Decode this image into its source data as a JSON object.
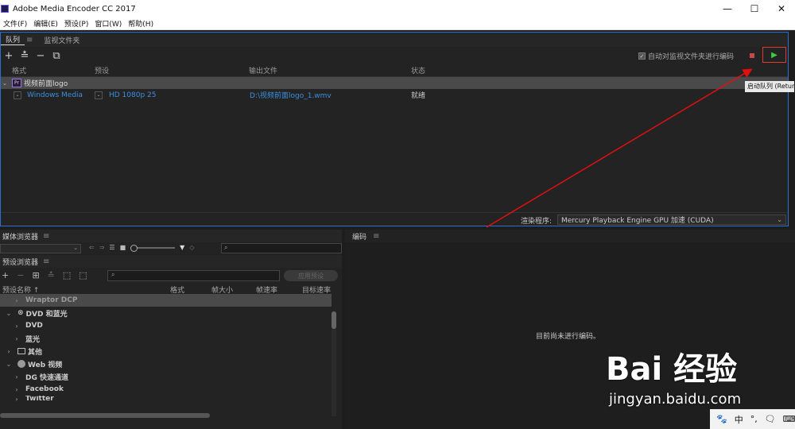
{
  "window": {
    "title": "Adobe Media Encoder CC 2017",
    "min": "—",
    "max": "☐",
    "close": "✕"
  },
  "menu": [
    "文件(F)",
    "编辑(E)",
    "预设(P)",
    "窗口(W)",
    "帮助(H)"
  ],
  "queue": {
    "tabs": [
      "队列",
      "监视文件夹"
    ],
    "auto_watch_label": "自动对监视文件夹进行编码",
    "auto_watch_checked": true,
    "tooltip": "启动队列 (Return)",
    "columns": [
      "格式",
      "预设",
      "输出文件",
      "状态"
    ],
    "group": {
      "badge": "Pr",
      "name": "视频前面logo"
    },
    "item": {
      "format": "Windows Media",
      "preset": "HD 1080p 25",
      "output": "D:\\视频前面logo_1.wmv",
      "status": "就绪"
    },
    "renderer_label": "渲染程序:",
    "renderer_value": "Mercury Playback Engine GPU 加速 (CUDA)"
  },
  "media_browser": {
    "title": "媒体浏览器",
    "search_icon": "search-icon"
  },
  "preset_browser": {
    "title": "预设浏览器",
    "apply_label": "应用预设",
    "columns": [
      "预设名称 ↑",
      "格式",
      "帧大小",
      "帧速率",
      "目标速率"
    ],
    "rows": [
      {
        "label": "Wraptor DCP",
        "level": 1,
        "arrow": "›",
        "selected": true
      },
      {
        "label": "DVD 和蓝光",
        "level": 0,
        "arrow": "⌄",
        "icon": "disc"
      },
      {
        "label": "DVD",
        "level": 1,
        "arrow": "›"
      },
      {
        "label": "蓝光",
        "level": 1,
        "arrow": "›"
      },
      {
        "label": "其他",
        "level": 0,
        "arrow": "›",
        "icon": "monitor"
      },
      {
        "label": "Web 视频",
        "level": 0,
        "arrow": "⌄",
        "icon": "globe"
      },
      {
        "label": "DG 快速通道",
        "level": 1,
        "arrow": "›"
      },
      {
        "label": "Facebook",
        "level": 1,
        "arrow": "›"
      },
      {
        "label": "Twitter",
        "level": 1,
        "arrow": "›"
      }
    ]
  },
  "encoding": {
    "title": "编码",
    "idle_message": "目前尚未进行编码。"
  },
  "watermark": {
    "logo": "Bai 经验",
    "url": "jingyan.baidu.com"
  },
  "tray": [
    "🐾",
    "中",
    "°,",
    "🗨",
    "⌨"
  ]
}
